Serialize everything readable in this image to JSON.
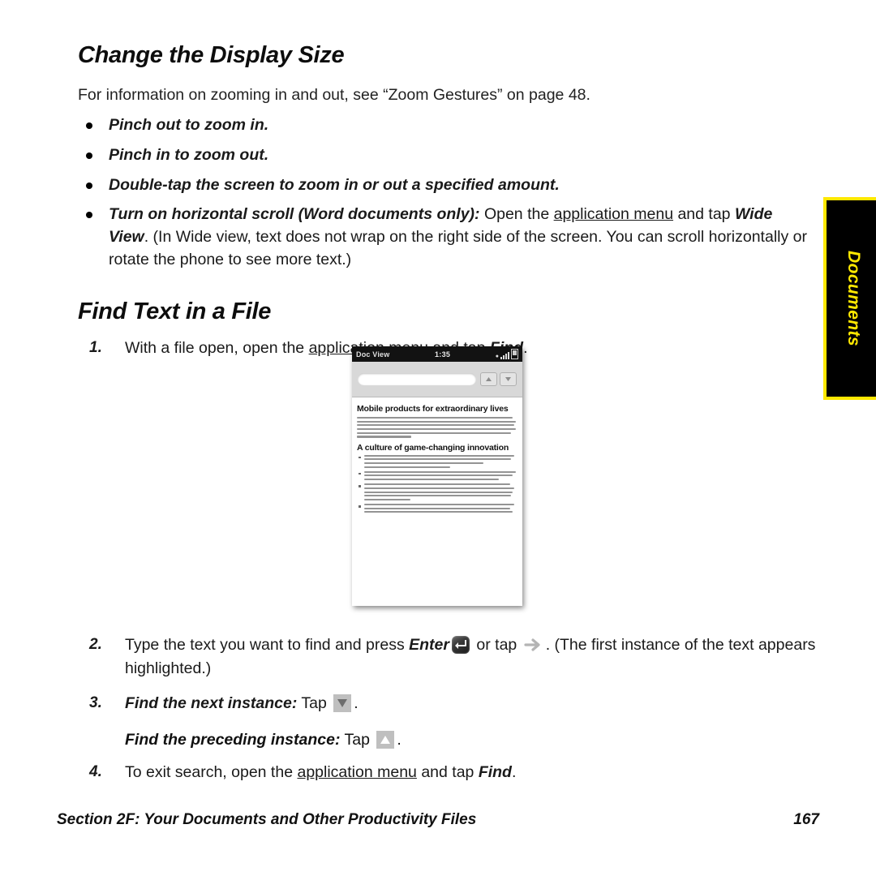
{
  "side_tab": {
    "label": "Documents",
    "bg_color": "#000000",
    "text_color": "#ffe800",
    "border_color": "#ffe800"
  },
  "sections": [
    {
      "title": "Change the Display Size",
      "intro": "For information on zooming in and out, see “Zoom Gestures” on page 48.",
      "bullets": [
        {
          "lead": "Pinch out to zoom in.",
          "rest": ""
        },
        {
          "lead": "Pinch in to zoom out.",
          "rest": ""
        },
        {
          "lead": "Double-tap the screen to zoom in or out a specified amount.",
          "rest": ""
        },
        {
          "lead": "Turn on horizontal scroll (Word documents only):",
          "rest_a": " Open the ",
          "link": "application menu",
          "rest_b": " and tap ",
          "emph": "Wide View",
          "rest_c": ". (In Wide view, text does not wrap on the right side of the screen. You can scroll horizontally or rotate the phone to see more text.)"
        }
      ]
    },
    {
      "title": "Find Text in a File",
      "steps": [
        {
          "number": "1.",
          "text_a": "With a file open, open the ",
          "link": "application menu",
          "text_b": " and tap ",
          "emph": "Find",
          "text_c": "."
        },
        {
          "number": "2.",
          "text_a": "Type the text you want to find and press ",
          "emph": "Enter",
          "icon_1": "enter-key-icon",
          "text_b": " or tap ",
          "icon_2": "right-arrow-icon",
          "text_c": ". (The first instance of the text appears highlighted.)"
        },
        {
          "number": "3.",
          "emph": "Find the next instance:",
          "text_a": " Tap ",
          "icon_1": "down-triangle-icon",
          "text_b": "."
        },
        {
          "number": "4.",
          "text_a": "To exit search, open the ",
          "link": "application menu",
          "text_b": " and tap ",
          "emph": "Find",
          "text_c": "."
        }
      ],
      "sub_line": {
        "emph": "Find the preceding instance:",
        "text_a": " Tap ",
        "icon_1": "up-triangle-icon",
        "text_b": "."
      }
    }
  ],
  "phone_screenshot": {
    "status_bar": {
      "app_name": "Doc View",
      "time": "1:35",
      "signal_icon": "signal-bars-icon",
      "battery_icon": "battery-icon"
    },
    "find_bar": {
      "field_value": "",
      "prev_button_icon": "up-triangle-icon",
      "next_button_icon": "down-triangle-icon"
    },
    "document": {
      "heading_1": "Mobile products for extraordinary lives",
      "heading_2": "A culture of game-changing innovation",
      "paragraph_line_count": 6,
      "bullet_count": 4
    }
  },
  "footer": {
    "section_text": "Section 2F: Your Documents and Other Productivity Files",
    "page_number": "167"
  }
}
